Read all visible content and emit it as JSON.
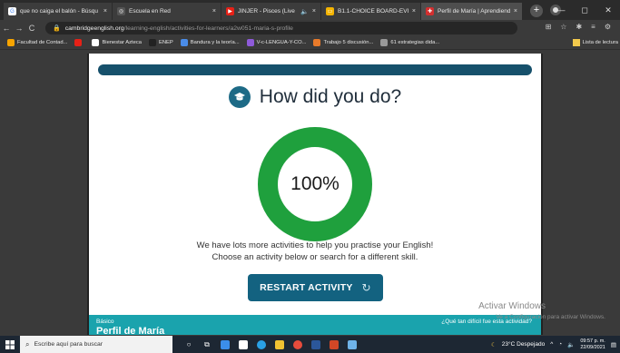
{
  "browser": {
    "tabs": [
      {
        "title": "que no caiga el balón - Búsqu",
        "fav_color": "#ffffff",
        "fav_text": "G",
        "fav_fg": "#4285f4"
      },
      {
        "title": "Escuela en Red",
        "fav_color": "#555555",
        "fav_text": "◎",
        "fav_fg": "#ffffff"
      },
      {
        "title": "JINJER - Pisces (Live Ses",
        "fav_color": "#e62117",
        "fav_text": "▶",
        "fav_fg": "#ffffff"
      },
      {
        "title": "B1.1-CHOICE BOARD-EVIDE",
        "fav_color": "#f4b400",
        "fav_text": "▭",
        "fav_fg": "#ffffff"
      },
      {
        "title": "Perfil de María | Aprendiend",
        "fav_color": "#d32f2f",
        "fav_text": "✚",
        "fav_fg": "#ffffff"
      }
    ],
    "tab_close": "×",
    "audio_icon": "🔈",
    "new_tab": "+",
    "window_controls": {
      "minimize": "—",
      "maximize": "◻",
      "close": "✕"
    },
    "url_host": "cambridgeenglish.org",
    "url_path": "/learning-english/activities-for-learners/a2w051-maria-s-profile",
    "bookmarks": [
      {
        "label": "Facultad de Contad...",
        "color": "#f7a400"
      },
      {
        "label": "",
        "color": "#e62117"
      },
      {
        "label": "Bienestar Azteca",
        "color": "#ffffff"
      },
      {
        "label": "ENEP",
        "color": "#222222"
      },
      {
        "label": "Bandura y la teoría...",
        "color": "#4a8ce8"
      },
      {
        "label": "V-c-LENGUA-Y-CO...",
        "color": "#8e5ad9"
      },
      {
        "label": "Trabajo 5 discusión...",
        "color": "#e87a2a"
      },
      {
        "label": "61 estrategias dida...",
        "color": "#999999"
      }
    ],
    "reading_list": "Lista de lectura"
  },
  "activity": {
    "heading": "How did you do?",
    "score_text": "100%",
    "score_fraction": 1.0,
    "ring_color": "#1fa03d",
    "message_line1": "We have lots more activities to help you practise your English!",
    "message_line2": "Choose an activity below or search for a different skill.",
    "restart_label": "RESTART ACTIVITY",
    "footer_level": "Básico",
    "footer_question": "¿Qué tan difícil fue esta actividad?",
    "footer_title": "Perfil de María"
  },
  "windows_watermark": {
    "line1": "Activar Windows",
    "line2": "Ve a Configuración para activar Windows."
  },
  "taskbar": {
    "search_placeholder": "Escribe aquí para buscar",
    "weather": "23°C  Despejado",
    "time": "09:57 p. m.",
    "date": "22/09/2021"
  }
}
